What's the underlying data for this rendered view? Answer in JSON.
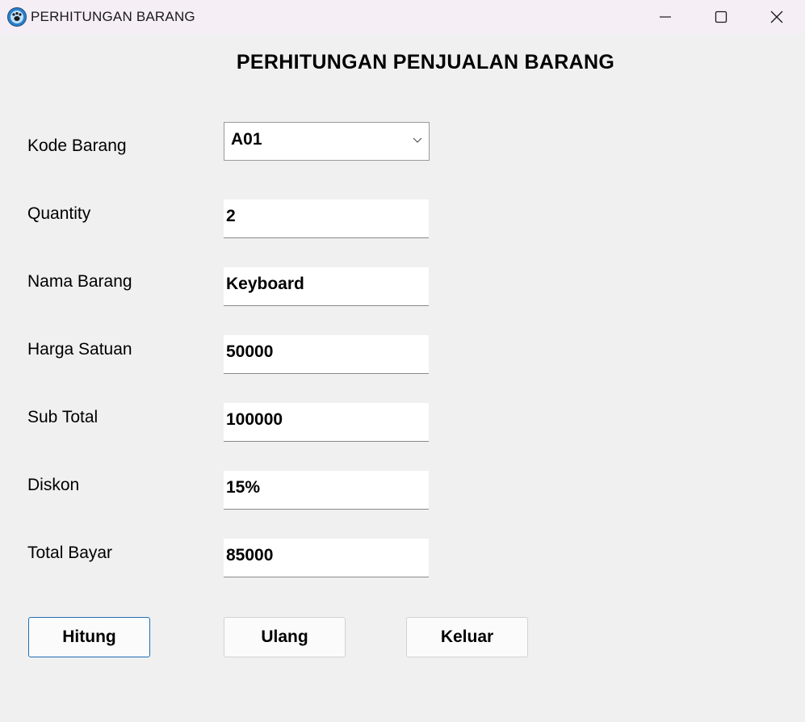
{
  "window": {
    "title": "PERHITUNGAN BARANG",
    "icon": "paw-icon",
    "controls": [
      "minimize-icon",
      "maximize-icon",
      "close-icon"
    ]
  },
  "heading": "PERHITUNGAN PENJUALAN BARANG",
  "form": {
    "kode_barang": {
      "label": "Kode Barang",
      "value": "A01"
    },
    "quantity": {
      "label": "Quantity",
      "value": "2"
    },
    "nama_barang": {
      "label": "Nama Barang",
      "value": "Keyboard"
    },
    "harga_satuan": {
      "label": "Harga Satuan",
      "value": "50000"
    },
    "sub_total": {
      "label": "Sub Total",
      "value": "100000"
    },
    "diskon": {
      "label": "Diskon",
      "value": "15%"
    },
    "total_bayar": {
      "label": "Total Bayar",
      "value": "85000"
    }
  },
  "buttons": {
    "hitung": "Hitung",
    "ulang": "Ulang",
    "keluar": "Keluar"
  },
  "colors": {
    "titlebar": "#f6eef5",
    "window_bg": "#f0f0f0",
    "default_button_border": "#1f6fb2"
  }
}
